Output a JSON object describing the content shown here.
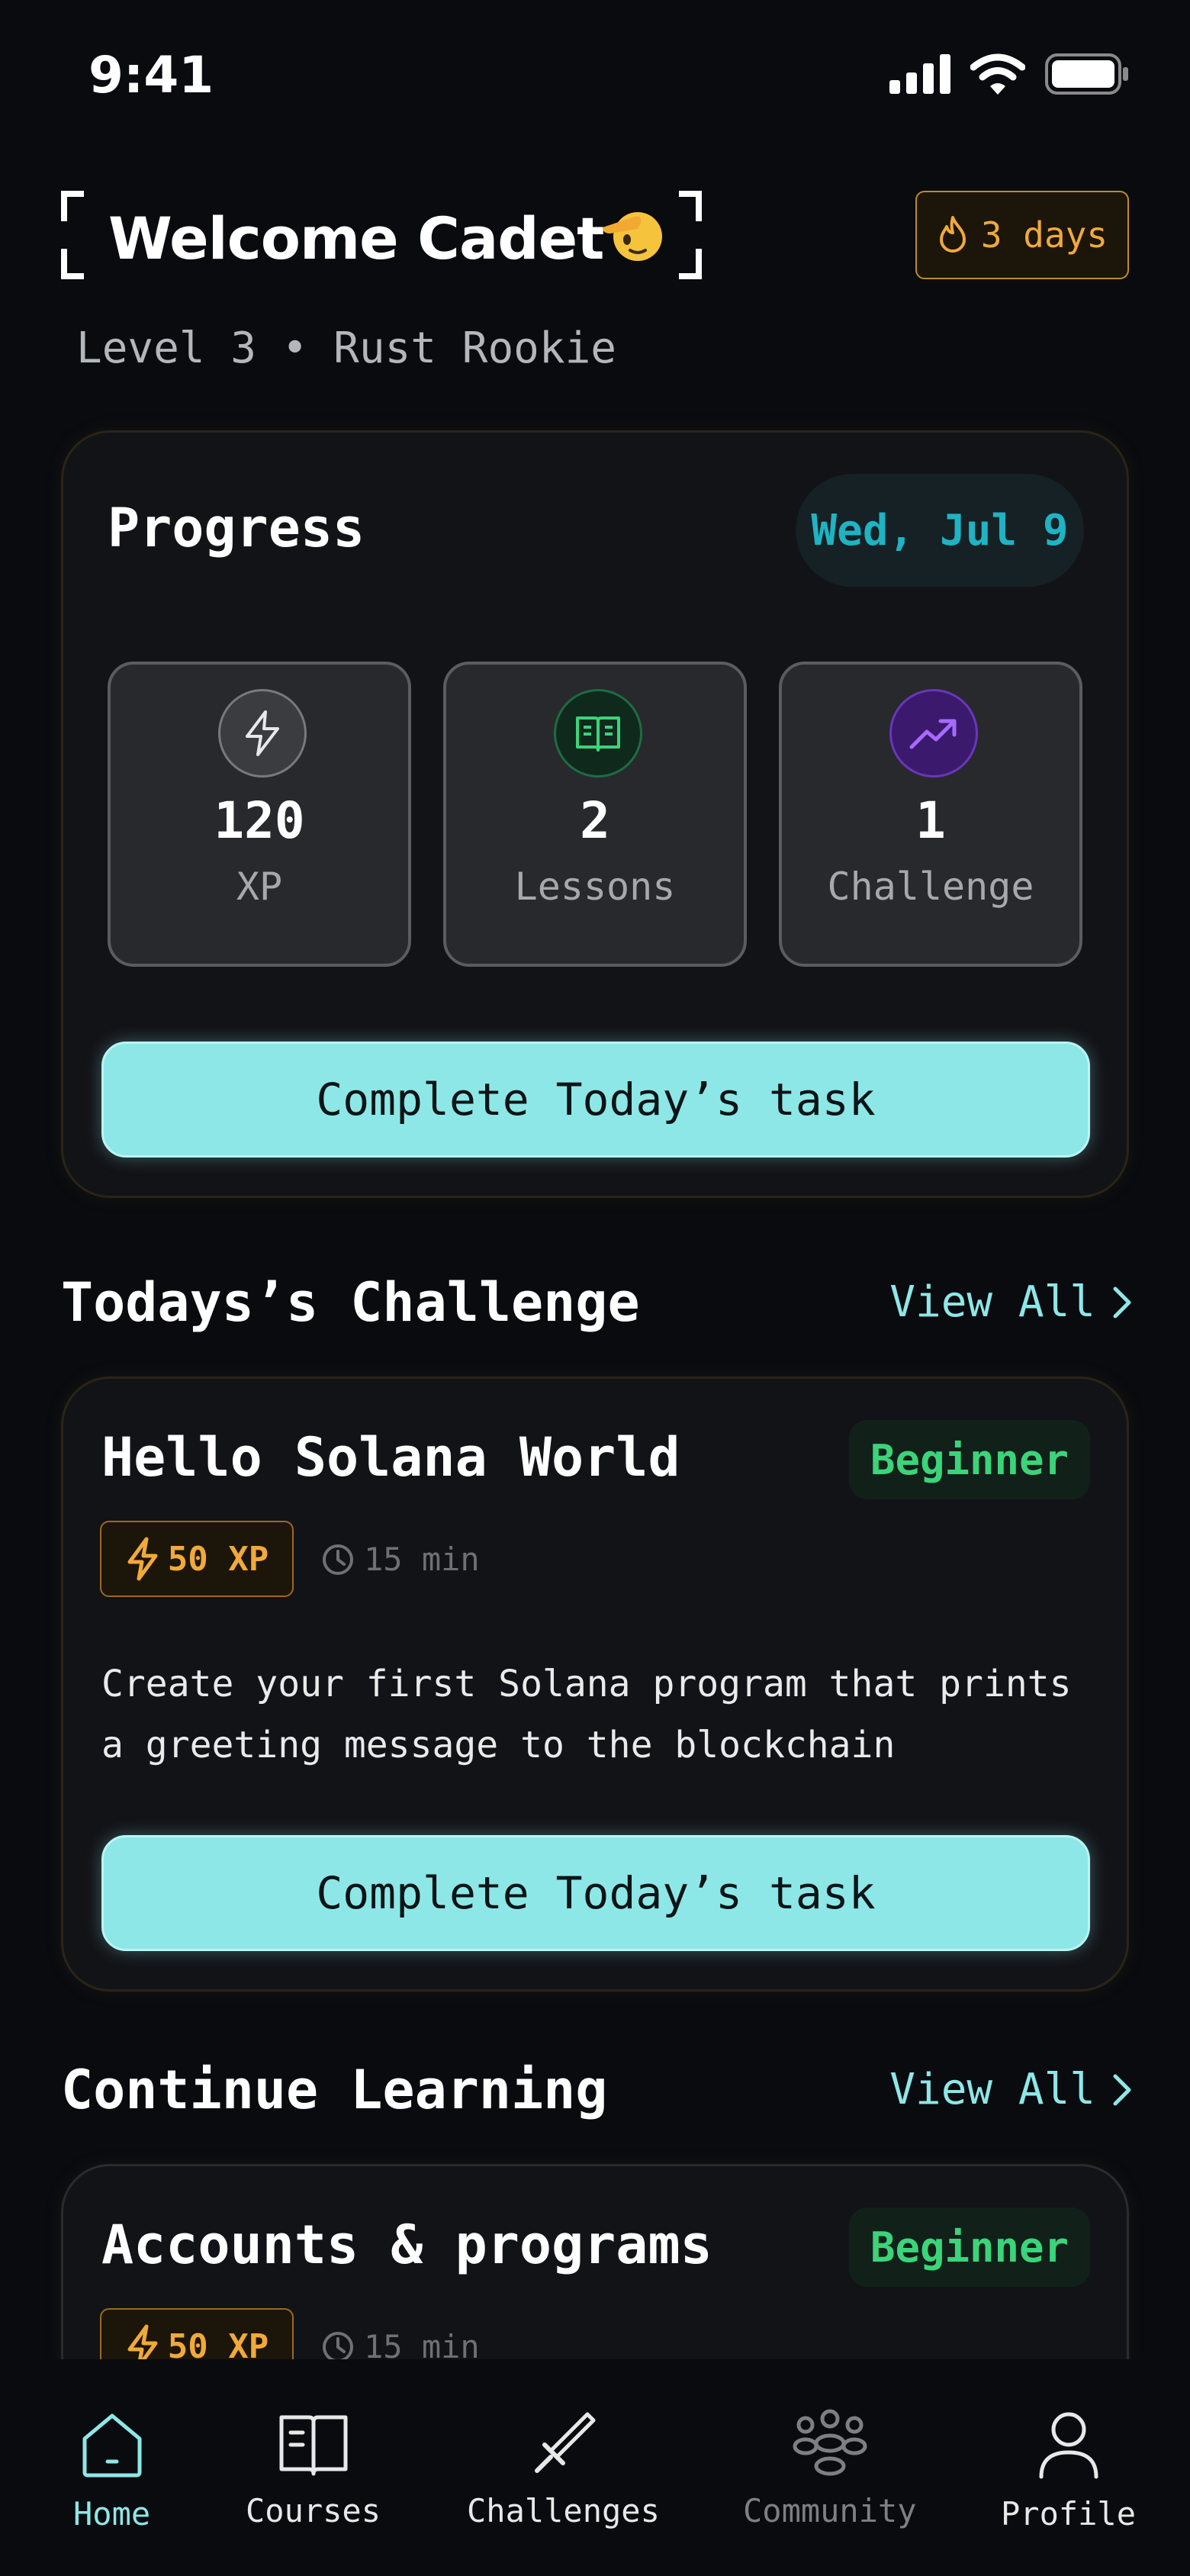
{
  "status_bar": {
    "time": "9:41"
  },
  "header": {
    "title": "Welcome Cadet",
    "level_text": "Level 3 • Rust Rookie",
    "streak": "3 days"
  },
  "progress": {
    "title": "Progress",
    "date": "Wed, Jul 9",
    "stats": [
      {
        "value": "120",
        "label": "XP",
        "icon": "lightning-icon"
      },
      {
        "value": "2",
        "label": "Lessons",
        "icon": "book-icon"
      },
      {
        "value": "1",
        "label": "Challenge",
        "icon": "trending-up-icon"
      }
    ],
    "cta_label": "Complete Today’s task"
  },
  "challenge_section": {
    "title": "Todays’s Challenge",
    "view_all": "View All",
    "card": {
      "title": "Hello Solana World",
      "difficulty": "Beginner",
      "xp": "50 XP",
      "duration": "15 min",
      "description": "Create your first Solana program that prints a greeting message to the blockchain",
      "cta_label": "Complete Today’s task"
    }
  },
  "learning_section": {
    "title": "Continue Learning",
    "view_all": "View All",
    "card": {
      "title": "Accounts & programs",
      "difficulty": "Beginner",
      "xp": "50 XP",
      "duration": "15 min"
    }
  },
  "bottom_nav": {
    "items": [
      {
        "label": "Home",
        "icon": "home-icon",
        "active": true
      },
      {
        "label": "Courses",
        "icon": "book-icon"
      },
      {
        "label": "Challenges",
        "icon": "sword-icon"
      },
      {
        "label": "Community",
        "icon": "people-icon"
      },
      {
        "label": "Profile",
        "icon": "user-icon"
      }
    ]
  },
  "colors": {
    "background": "#090b0f",
    "accent_cyan": "#8ee7e7",
    "streak_orange": "#f0a93a",
    "beginner_green": "#3bd47a",
    "date_blue": "#1fb3c4"
  }
}
